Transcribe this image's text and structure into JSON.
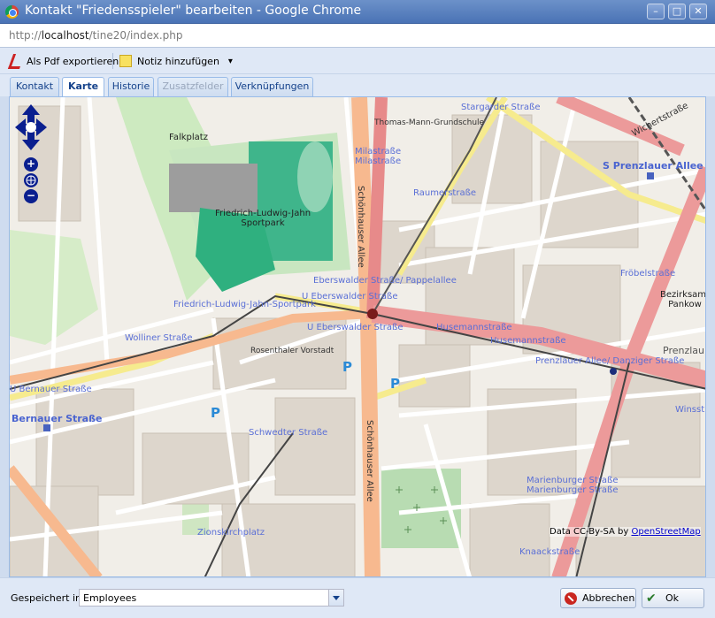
{
  "window": {
    "title": "Kontakt \"Friedensspieler\" bearbeiten - Google Chrome",
    "controls": {
      "minimize": "–",
      "maximize": "□",
      "close": "✕"
    }
  },
  "address": {
    "scheme": "http://",
    "host": "localhost",
    "path": "/tine20/index.php"
  },
  "toolbar": {
    "export_pdf": "Als Pdf exportieren",
    "add_note": "Notiz hinzufügen",
    "dropdown_arrow": "▾"
  },
  "tabs": [
    {
      "label": "Kontakt",
      "state": "normal"
    },
    {
      "label": "Karte",
      "state": "active"
    },
    {
      "label": "Historie",
      "state": "normal"
    },
    {
      "label": "Zusatzfelder",
      "state": "disabled"
    },
    {
      "label": "Verknüpfungen",
      "state": "normal"
    }
  ],
  "map": {
    "labels": {
      "falkplatz": "Falkplatz",
      "sportpark": "Friedrich-Ludwig-Jahn\nSportpark",
      "sportpark_stop": "Friedrich-Ludwig-Jahn-Sportpark",
      "thomas_mann": "Thomas-Mann-Grundschule",
      "stargarder": "Stargarder Straße",
      "milastrasse": "Milastraße\nMilastraße",
      "raumerstrasse": "Raumerstraße",
      "prenzlauer_allee_s": "S Prenzlauer Allee",
      "eberswalder_pappel": "Eberswalder Straße/ Pappelallee",
      "u_eberswalder_1": "U Eberswalder Straße",
      "u_eberswalder_2": "U Eberswalder Straße",
      "husemann_1": "Husemannstraße",
      "husemann_2": "Husemannstraße",
      "froebel": "Fröbelstraße",
      "bezirksamt": "Bezirksamt\nPankow",
      "prenzlauer_danziger": "Prenzlauer Allee/ Danziger Straße",
      "prenzlau": "Prenzlau",
      "wolliner": "Wolliner Straße",
      "u_bernauer": "U Bernauer Straße",
      "bernauer": "Bernauer Straße",
      "schwedter_stop": "Schwedter Straße",
      "zionskirchplatz": "Zionskirchplatz",
      "marienburger": "Marienburger Straße\nMarienburger Straße",
      "knaackstrasse": "Knaackstraße",
      "winsstr": "Winsstr",
      "wichertstrasse": "Wichertstraße",
      "schoenhauser": "Schönhauser Allee",
      "rosenthaler": "Rosenthaler Vorstadt"
    },
    "attribution_text": "Data CC-By-SA by ",
    "attribution_link": "OpenStreetMap",
    "parking": "P",
    "zoom_in": "+",
    "zoom_out": "−"
  },
  "footer": {
    "saved_in_label": "Gespeichert in",
    "saved_in_value": "Employees",
    "cancel": "Abbrechen",
    "ok": "Ok"
  }
}
